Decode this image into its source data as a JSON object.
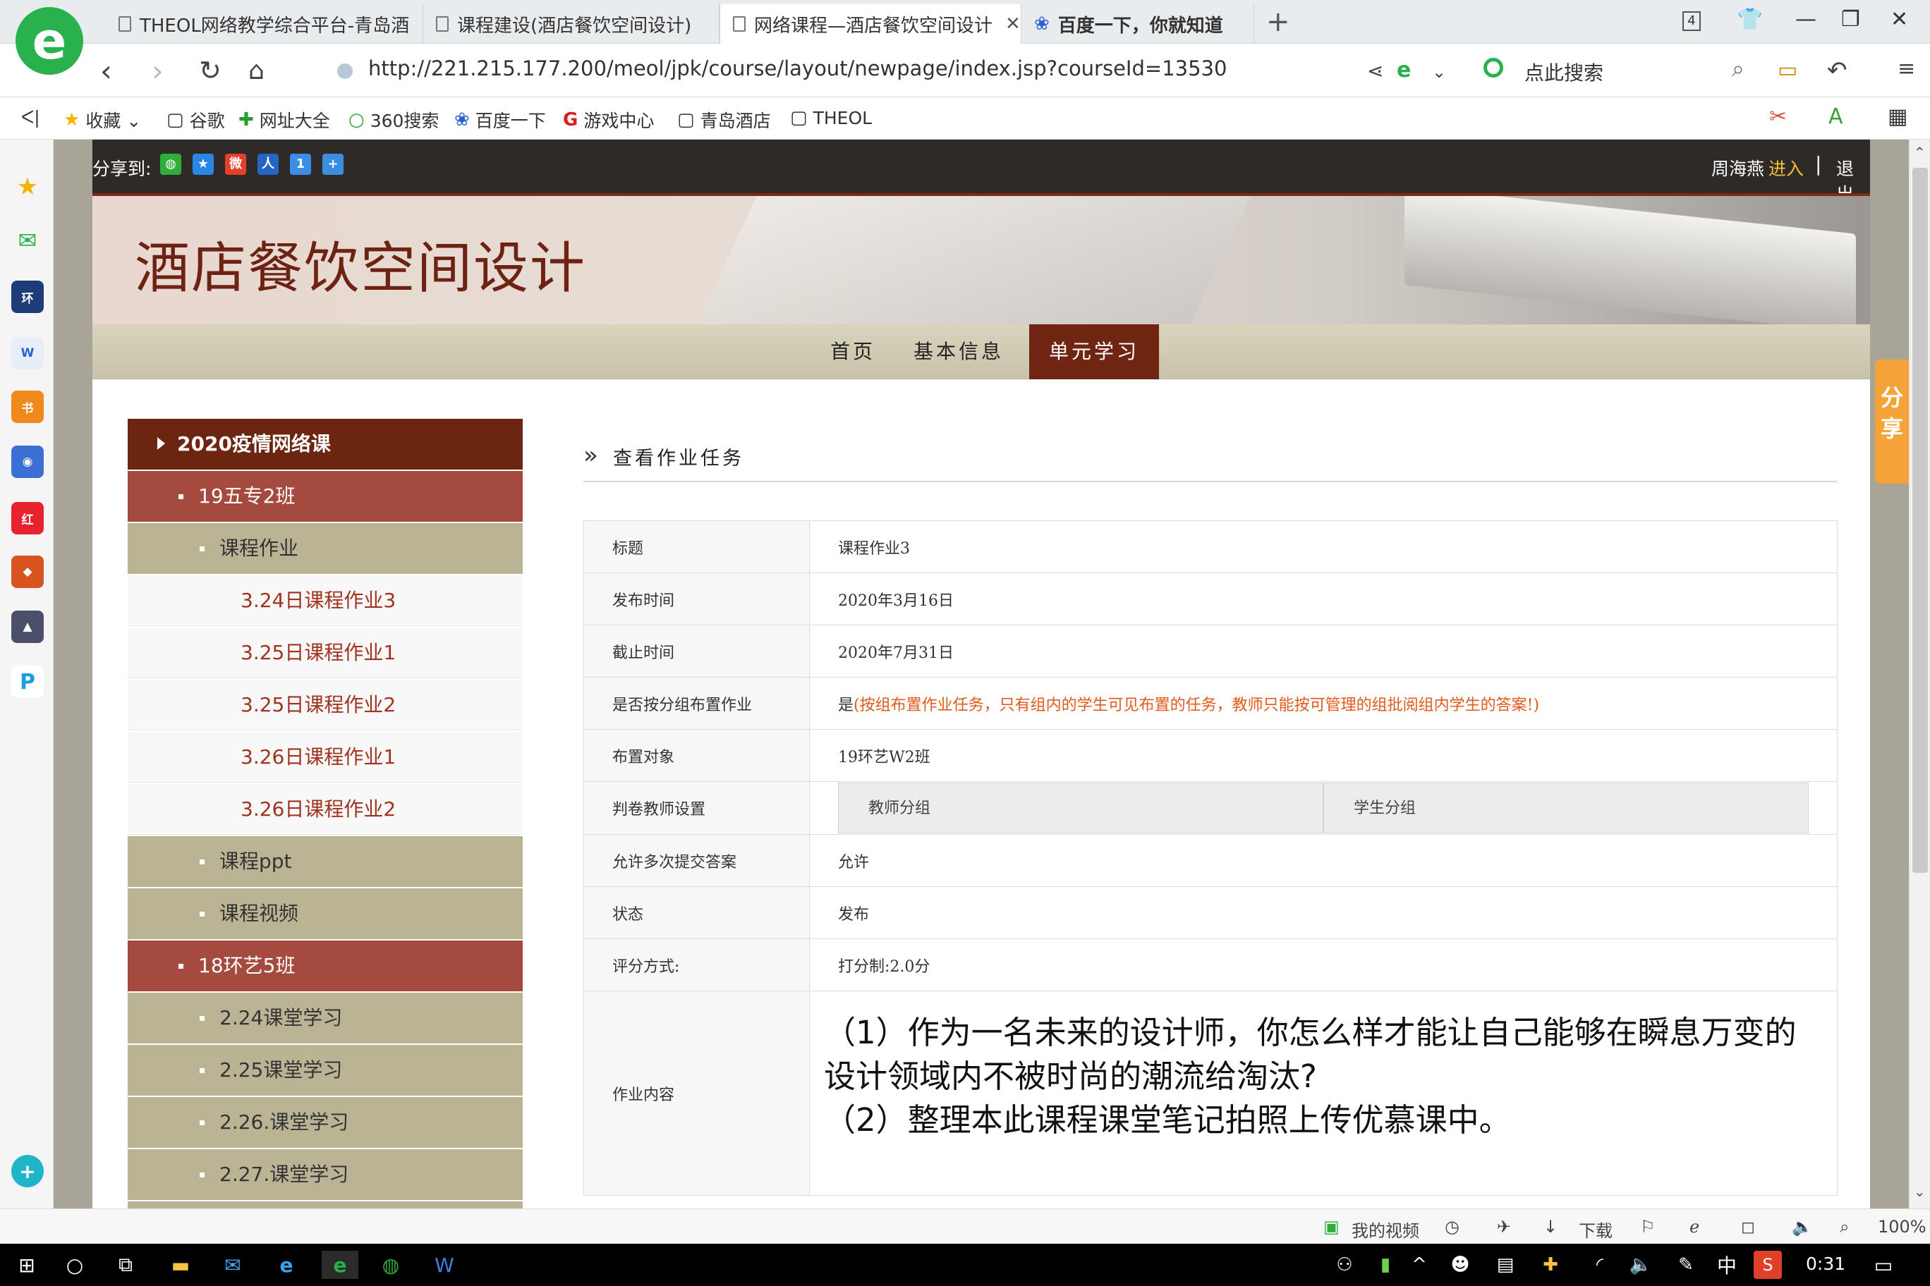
{
  "browser": {
    "logo_letter": "e",
    "tabs": [
      {
        "title": "THEOL网络教学综合平台-青岛酒",
        "active": false
      },
      {
        "title": "课程建设(酒店餐饮空间设计)",
        "active": false
      },
      {
        "title": "网络课程—酒店餐饮空间设计",
        "active": true
      },
      {
        "title": "百度一下，你就知道",
        "active": false
      }
    ],
    "tab_count": "4",
    "url": "http://221.215.177.200/meol/jpk/course/layout/newpage/index.jsp?courseId=13530",
    "search_placeholder": "点此搜索",
    "bookmarks": [
      {
        "icon": "★",
        "label": "收藏 ⌄"
      },
      {
        "icon": "▢",
        "label": "谷歌"
      },
      {
        "icon": "✚",
        "label": "网址大全"
      },
      {
        "icon": "○",
        "label": "360搜索"
      },
      {
        "icon": "❀",
        "label": "百度一下"
      },
      {
        "icon": "G",
        "label": "游戏中心"
      },
      {
        "icon": "▢",
        "label": "青岛酒店"
      },
      {
        "icon": "▢",
        "label": "THEOL"
      }
    ]
  },
  "site": {
    "share_label": "分享到:",
    "user_name": "周海燕",
    "enter_label": "进入",
    "sep": "|",
    "logout_label": "退出",
    "course_title": "酒店餐饮空间设计",
    "nav": [
      {
        "label": "首页",
        "active": false
      },
      {
        "label": "基本信息",
        "active": false
      },
      {
        "label": "单元学习",
        "active": true
      }
    ],
    "tree": [
      {
        "level": 0,
        "label": "2020疫情网络课"
      },
      {
        "level": 1,
        "label": "19五专2班"
      },
      {
        "level": 2,
        "label": "课程作业"
      },
      {
        "level": 3,
        "label": "3.24日课程作业3"
      },
      {
        "level": 3,
        "label": "3.25日课程作业1"
      },
      {
        "level": 3,
        "label": "3.25日课程作业2"
      },
      {
        "level": 3,
        "label": "3.26日课程作业1"
      },
      {
        "level": 3,
        "label": "3.26日课程作业2"
      },
      {
        "level": 2,
        "label": "课程ppt"
      },
      {
        "level": 2,
        "label": "课程视频"
      },
      {
        "level": 1,
        "label": "18环艺5班"
      },
      {
        "level": 2,
        "label": "2.24课堂学习"
      },
      {
        "level": 2,
        "label": "2.25课堂学习"
      },
      {
        "level": 2,
        "label": "2.26.课堂学习"
      },
      {
        "level": 2,
        "label": "2.27.课堂学习"
      }
    ],
    "panel_title": "查看作业任务",
    "rows": {
      "title_label": "标题",
      "title_value": "课程作业3",
      "publish_label": "发布时间",
      "publish_value": "2020年3月16日",
      "deadline_label": "截止时间",
      "deadline_value": "2020年7月31日",
      "group_label": "是否按分组布置作业",
      "group_value": "是",
      "group_note": "(按组布置作业任务，只有组内的学生可见布置的任务，教师只能按可管理的组批阅组内学生的答案!)",
      "target_label": "布置对象",
      "target_value": "19环艺W2班",
      "grader_label": "判卷教师设置",
      "grader_teacher": "教师分组",
      "grader_student": "学生分组",
      "multi_label": "允许多次提交答案",
      "multi_value": "允许",
      "status_label": "状态",
      "status_value": "发布",
      "score_label": "评分方式:",
      "score_value": "打分制:2.0分",
      "content_label": "作业内容",
      "content_line1": "（1）作为一名未来的设计师，你怎么样才能让自己能够在瞬息万变的设计领域内不被时尚的潮流给淘汰?",
      "content_line2": "（2）整理本此课程课堂笔记拍照上传优慕课中。"
    },
    "side_share": "分享"
  },
  "statusbar": {
    "my_video": "我的视频",
    "download": "下载",
    "zoom": "100%"
  },
  "taskbar": {
    "ime": "中",
    "time": "0:31"
  },
  "colors": {
    "nav_active": "#6f2511",
    "tree_level0": "#6c2511",
    "tree_level1": "#a54a3e",
    "tree_level2": "#bab495",
    "leaf_text": "#a0331f",
    "note_orange": "#e05a1a",
    "browser_green": "#28b14c"
  }
}
